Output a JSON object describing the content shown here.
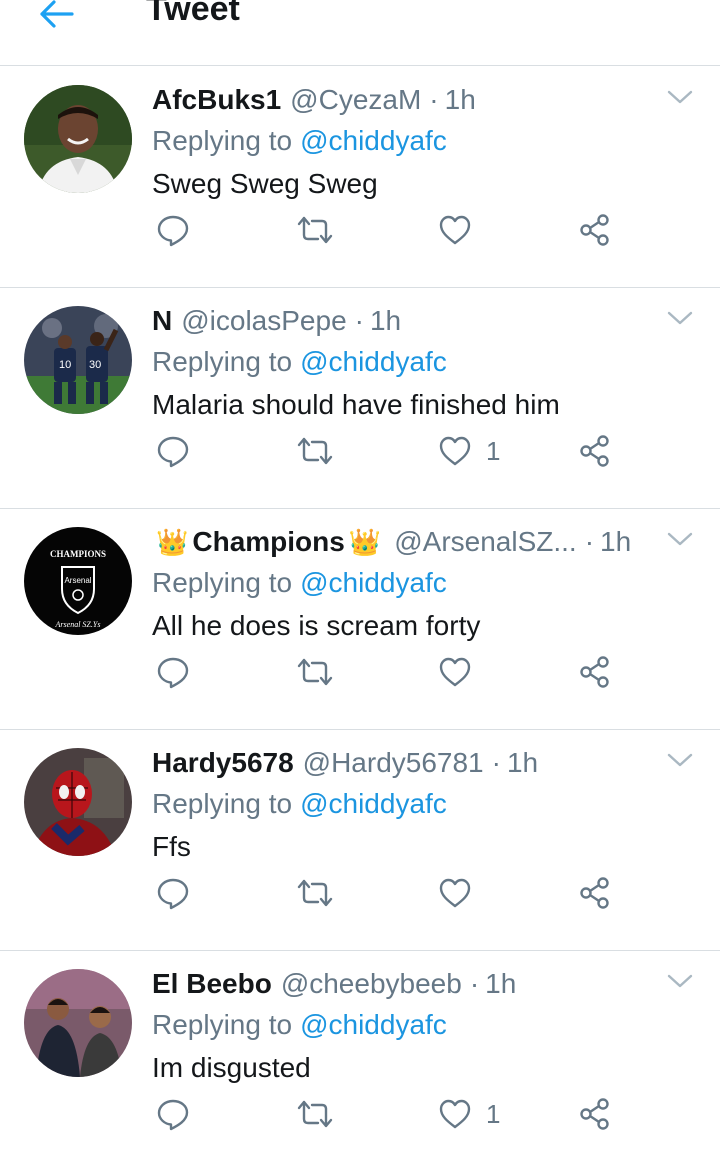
{
  "header": {
    "title": "Tweet",
    "back_icon": "arrow-left-icon",
    "accent": "#1da1f2"
  },
  "colors": {
    "secondary_text": "#657786",
    "link": "#1b95e0",
    "divider": "#d9dee2"
  },
  "tweets": [
    {
      "name": "AfcBuks1",
      "handle": "@CyezaM",
      "time": "1h",
      "replying_label": "Replying to",
      "replying_to": "@chiddyafc",
      "text": "Sweg Sweg Sweg",
      "like_count": "",
      "avatar": "avatar-player-portrait"
    },
    {
      "name": "N",
      "handle": "@icolasPepe",
      "time": "1h",
      "replying_label": "Replying to",
      "replying_to": "@chiddyafc",
      "text": "Malaria should have finished him",
      "like_count": "1",
      "avatar": "avatar-football-players"
    },
    {
      "name_prefix": "👑",
      "name": "Champions",
      "name_suffix": "👑",
      "handle": "@ArsenalSZ...",
      "time": "1h",
      "replying_label": "Replying to",
      "replying_to": "@chiddyafc",
      "text": "All he does is scream forty",
      "like_count": "",
      "avatar": "avatar-arsenal-logo"
    },
    {
      "name": "Hardy5678",
      "handle": "@Hardy56781",
      "time": "1h",
      "replying_label": "Replying to",
      "replying_to": "@chiddyafc",
      "text": "Ffs",
      "like_count": "",
      "avatar": "avatar-spiderman"
    },
    {
      "name": "El Beebo",
      "handle": "@cheebybeeb",
      "time": "1h",
      "replying_label": "Replying to",
      "replying_to": "@chiddyafc",
      "text": "Im disgusted",
      "like_count": "1",
      "avatar": "avatar-two-men"
    }
  ],
  "icons": {
    "reply": "reply-icon",
    "retweet": "retweet-icon",
    "like": "like-icon",
    "share": "share-icon",
    "menu": "chevron-down-icon"
  }
}
